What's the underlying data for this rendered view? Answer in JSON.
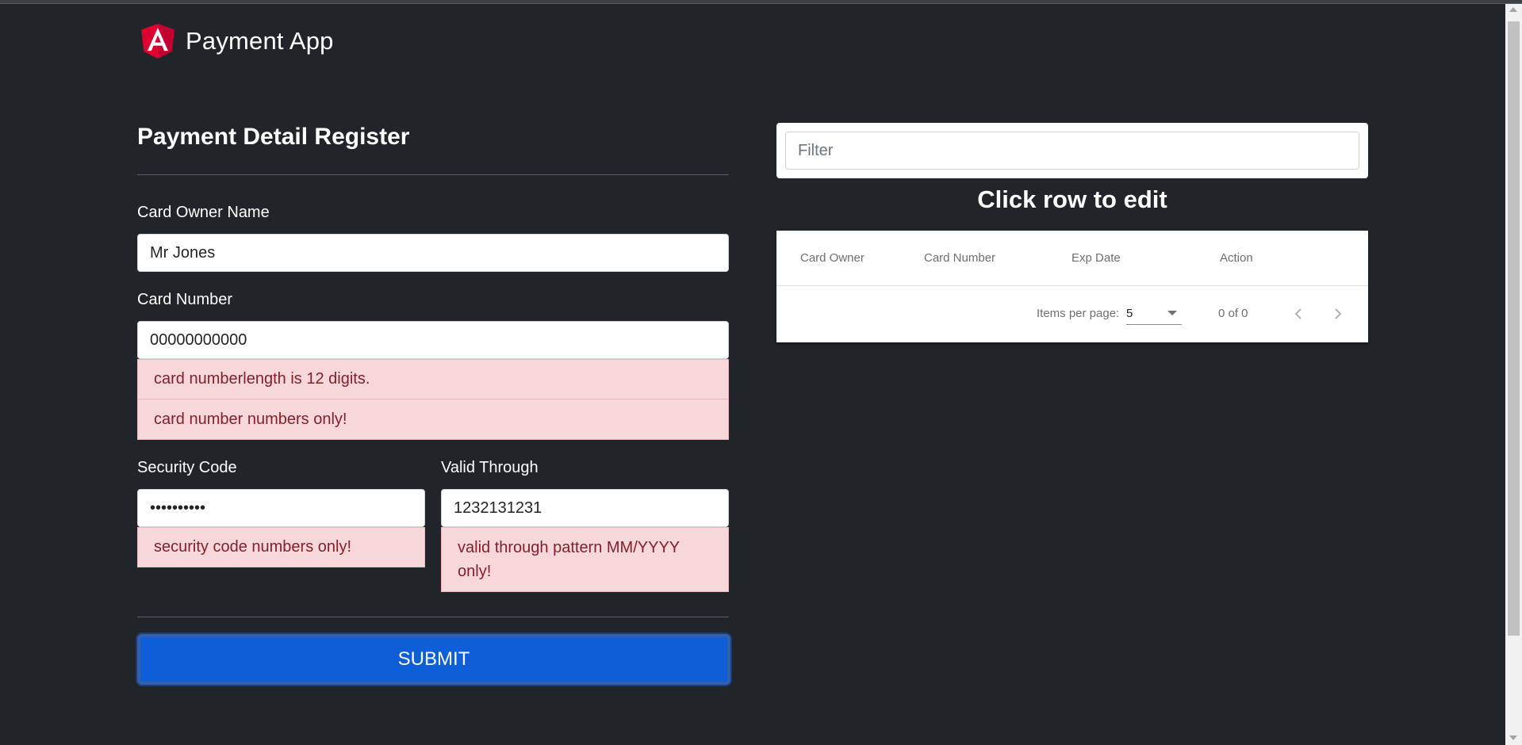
{
  "app": {
    "title": "Payment App",
    "logo": "angular-shield-logo"
  },
  "form": {
    "title": "Payment Detail Register",
    "card_owner": {
      "label": "Card Owner Name",
      "value": "Mr Jones"
    },
    "card_number": {
      "label": "Card Number",
      "value": "00000000000",
      "errors": [
        "card numberlength is 12 digits.",
        "card number numbers only!"
      ]
    },
    "security_code": {
      "label": "Security Code",
      "value": "••••••••••",
      "errors": [
        "security code numbers only!"
      ]
    },
    "valid_through": {
      "label": "Valid Through",
      "value": "1232131231",
      "errors": [
        "valid through pattern MM/YYYY only!"
      ]
    },
    "submit_label": "SUBMIT"
  },
  "list": {
    "filter_placeholder": "Filter",
    "hint": "Click row to edit",
    "columns": [
      "Card Owner",
      "Card Number",
      "Exp Date",
      "Action"
    ],
    "rows": [],
    "paginator": {
      "items_per_page_label": "Items per page:",
      "page_size": "5",
      "range_label": "0 of 0",
      "prev_icon": "chevron-left-icon",
      "next_icon": "chevron-right-icon"
    }
  },
  "colors": {
    "background": "#212529",
    "primary": "#0d5ed7",
    "error_bg": "#f8d7da",
    "error_text": "#842029",
    "angular_red": "#dd0031"
  }
}
